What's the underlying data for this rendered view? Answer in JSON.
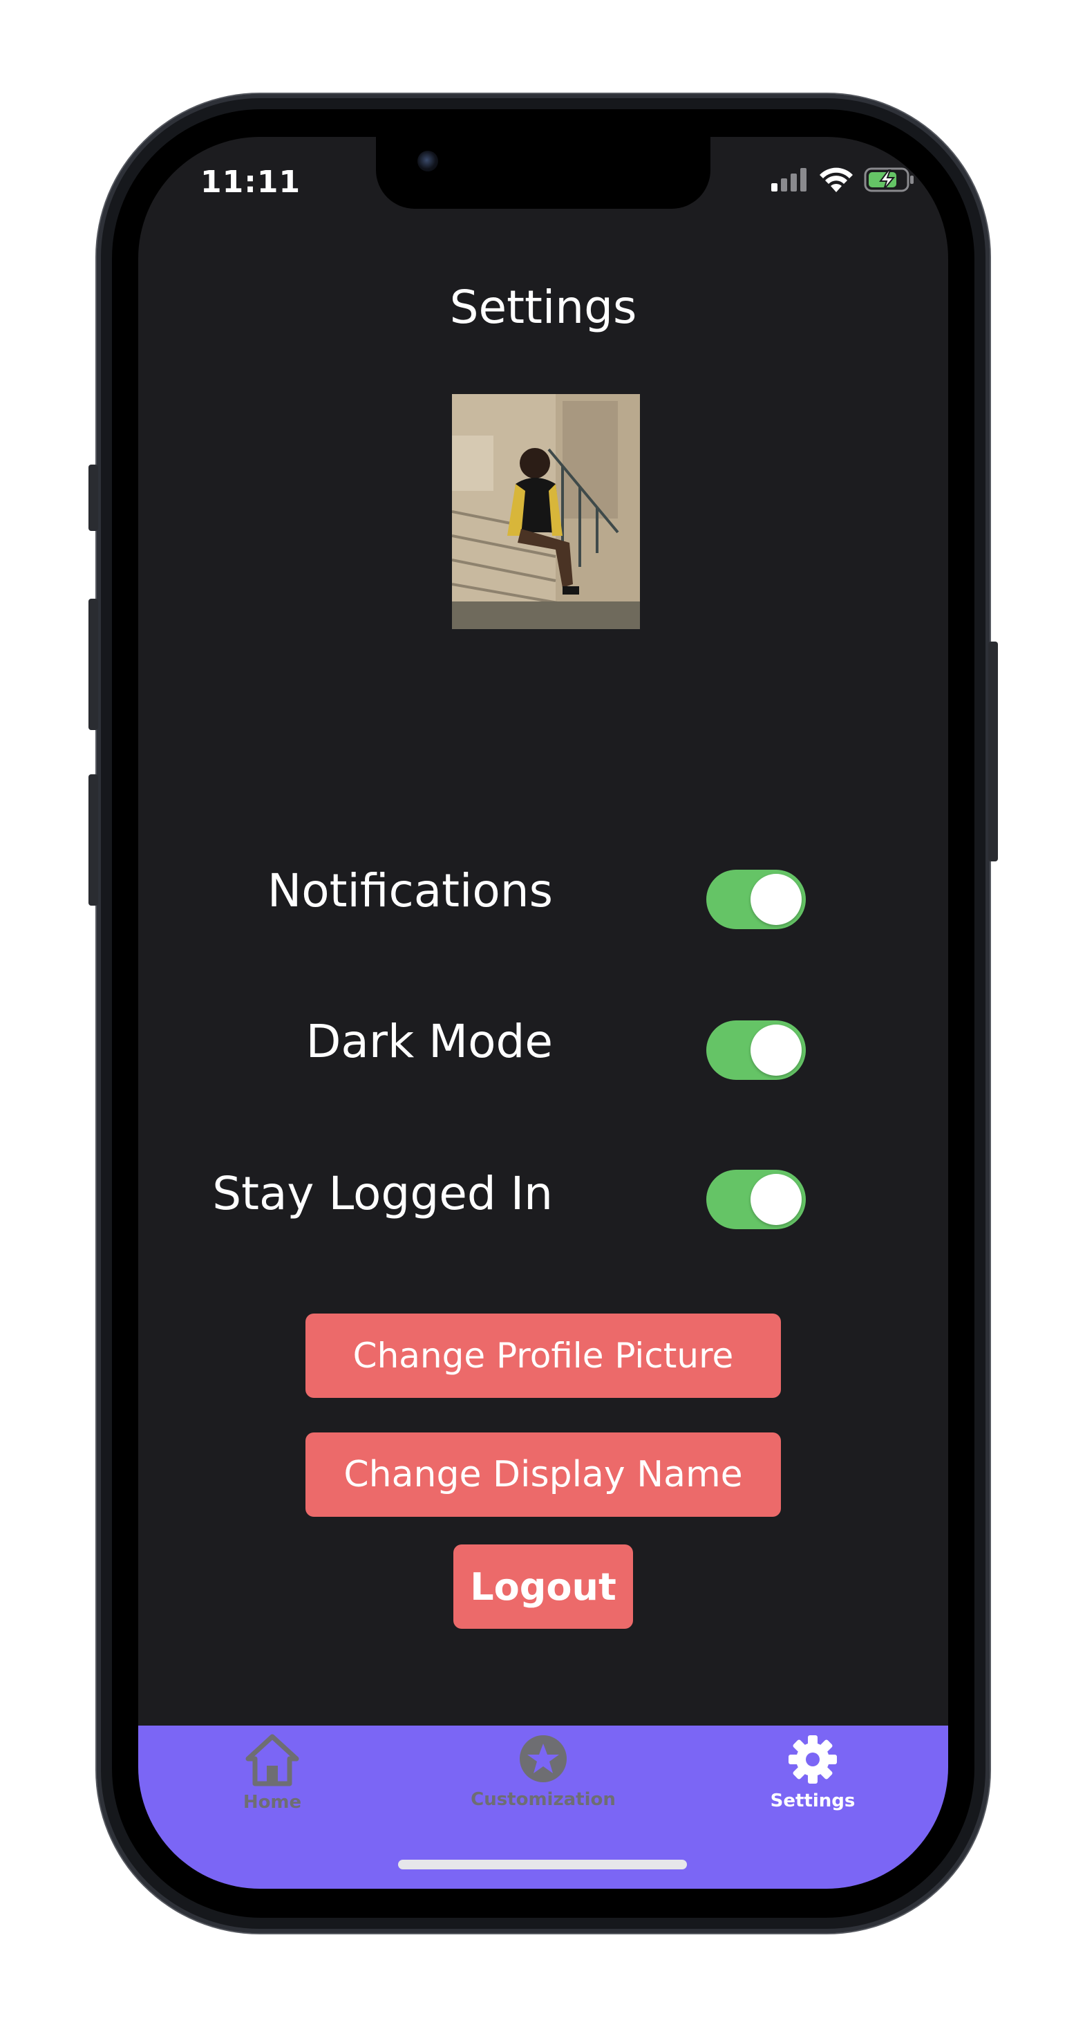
{
  "status_bar": {
    "time": "11:11",
    "icons": [
      "cellular-signal-icon",
      "wifi-icon",
      "battery-charging-icon"
    ]
  },
  "page": {
    "title": "Settings"
  },
  "profile": {
    "image_icon": "profile-photo"
  },
  "settings": [
    {
      "label": "Notifications",
      "enabled": true
    },
    {
      "label": "Dark Mode",
      "enabled": true
    },
    {
      "label": "Stay Logged In",
      "enabled": true
    }
  ],
  "buttons": {
    "change_picture": "Change Profile Picture",
    "change_name": "Change Display Name",
    "logout": "Logout"
  },
  "tabbar": {
    "tabs": [
      {
        "label": "Home",
        "icon": "home-icon",
        "active": false
      },
      {
        "label": "Customization",
        "icon": "star-circle-icon",
        "active": false
      },
      {
        "label": "Settings",
        "icon": "gear-icon",
        "active": true
      }
    ]
  },
  "colors": {
    "background": "#1c1c1f",
    "toggle_on": "#65c466",
    "button": "#ec6a6a",
    "tabbar": "#7b66f5",
    "tab_active": "#ffffff",
    "tab_inactive": "#6e6e72"
  }
}
